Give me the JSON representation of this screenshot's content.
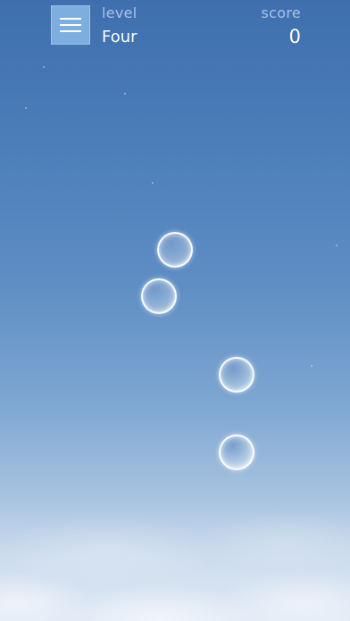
{
  "hud": {
    "level_label": "level",
    "level_value": "Four",
    "score_label": "score",
    "score_value": "0"
  },
  "menu_icon": "hamburger-menu-icon",
  "bubbles": [
    {
      "name": "bubble-1"
    },
    {
      "name": "bubble-2"
    },
    {
      "name": "bubble-3"
    },
    {
      "name": "bubble-4"
    }
  ],
  "colors": {
    "sky_top": "#3f6fae",
    "sky_bottom": "#dfe9f5",
    "menu_button": "#7eaee0",
    "label": "#a9c3e2",
    "value": "#ffffff"
  }
}
